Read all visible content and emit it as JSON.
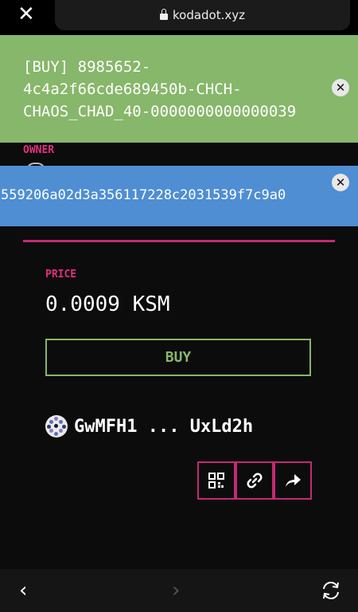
{
  "browser": {
    "url": "kodadot.xyz",
    "close_icon": "close-icon",
    "lock_icon": "lock-icon"
  },
  "notifications": {
    "buy": {
      "text": "[BUY] 8985652-4c4a2f66cde689450b-CHCH-CHAOS_CHAD_40-0000000000000039",
      "color": "#87b76a"
    },
    "hash": {
      "text": "559206a02d3a356117228c2031539f7c9a0",
      "color": "#4f8ed3"
    }
  },
  "owner_section": {
    "label": "OWNER"
  },
  "price": {
    "label": "PRICE",
    "value": "0.0009 KSM"
  },
  "buy_button": {
    "label": "BUY",
    "color": "#87b76a"
  },
  "owner": {
    "address": "GwMFH1 ... UxLd2h",
    "avatar_icon": "identicon-avatar"
  },
  "actions": [
    {
      "name": "qr-code-button",
      "icon": "qr-code-icon"
    },
    {
      "name": "copy-link-button",
      "icon": "link-icon"
    },
    {
      "name": "share-button",
      "icon": "share-icon"
    }
  ],
  "colors": {
    "accent": "#c42a72",
    "label_pink": "#e0307f",
    "background": "#0c0c0c"
  }
}
